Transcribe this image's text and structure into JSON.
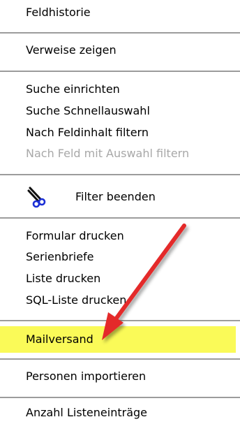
{
  "menu": {
    "items": [
      {
        "label": "Feldhistorie"
      },
      {
        "label": "Verweise zeigen"
      },
      {
        "label": "Suche einrichten"
      },
      {
        "label": "Suche Schnellauswahl"
      },
      {
        "label": "Nach Feldinhalt filtern"
      },
      {
        "label": "Nach Feld mit Auswahl filtern",
        "disabled": true
      },
      {
        "label": "Filter beenden",
        "icon": "scissors-icon"
      },
      {
        "label": "Formular drucken"
      },
      {
        "label": "Serienbriefe"
      },
      {
        "label": "Liste drucken"
      },
      {
        "label": "SQL-Liste drucken"
      },
      {
        "label": "Mailversand",
        "highlighted": true
      },
      {
        "label": "Personen importieren"
      },
      {
        "label": "Anzahl Listeneinträge"
      }
    ]
  },
  "colors": {
    "highlight": "#fafa58",
    "arrow": "#e42a2a",
    "disabled_text": "#a8a8a8",
    "separator": "#9c9c9c"
  }
}
